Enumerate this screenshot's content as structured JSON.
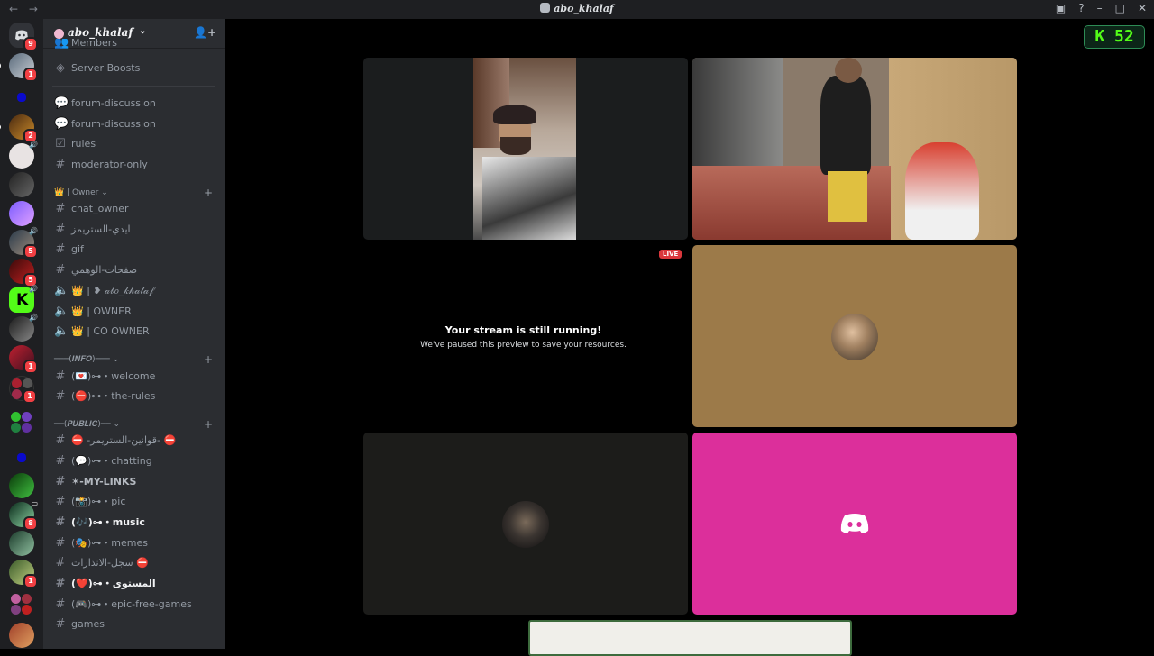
{
  "titlebar": {
    "title": "abo_khalaf",
    "back": "←",
    "forward": "→"
  },
  "servers": [
    {
      "badge": "9"
    },
    {
      "badge": "1"
    },
    {
      "badge": ""
    },
    {
      "badge": "2"
    },
    {
      "badge": ""
    },
    {
      "badge": ""
    },
    {
      "badge": ""
    },
    {
      "badge": "5"
    },
    {
      "badge": "5"
    },
    {
      "badge": ""
    },
    {
      "badge": ""
    },
    {
      "badge": "1"
    },
    {
      "badge": "1"
    },
    {
      "badge": ""
    },
    {
      "badge": ""
    },
    {
      "badge": ""
    },
    {
      "badge": "8"
    },
    {
      "badge": ""
    },
    {
      "badge": "1"
    },
    {
      "badge": ""
    },
    {
      "badge": ""
    }
  ],
  "sidebar": {
    "server_name": "abo_khalaf",
    "channels": {
      "members": "Members",
      "server_boosts": "Server Boosts",
      "forum1": "forum-discussion",
      "forum2": "forum-discussion",
      "rules": "rules",
      "moderator": "moderator-only",
      "cat_owner": "👑 | Owner",
      "chat_owner": "chat_owner",
      "streamers_id": "ايدي-الستريمز",
      "gif": "gif",
      "fake_pages": "صفحات-الوهمي",
      "voice1": "👑 | ❥ 𝒶𝒷𝑜_𝓀𝒽𝒶𝓁𝒶𝒻",
      "voice2": "👑 | OWNER",
      "voice3": "👑 | CO OWNER",
      "cat_info": "───(𝑰𝑵𝑭𝑶)───",
      "welcome": "(💌)⊶・welcome",
      "the_rules": "(⛔)⊶・the-rules",
      "cat_public": "──(𝑷𝑼𝑩𝑳𝑰𝑪)──",
      "streamer_rules": "⛔ -قوانين-الستريمر- ⛔",
      "chatting": "(💬)⊶・chatting",
      "my_links": "✶-MY-LINKS",
      "pic": "(📸)⊶・pic",
      "music": "(🎶)⊶・music",
      "memes": "(🎭)⊶・memes",
      "warnings": "سجل-الانذارات ⛔",
      "level": "(❤️)⊶・المستوى",
      "epic": "(🎮)⊶・epic-free-games",
      "games": "games"
    }
  },
  "stage": {
    "kick_badge": "K 52",
    "live_label": "LIVE",
    "stream_title": "Your stream is still running!",
    "stream_sub": "We've paused this preview to save your resources."
  },
  "colors": {
    "tile_brown": "#9c7a49",
    "tile_pink": "#dc2f9b",
    "tile_dark": "#1c1c1a",
    "sidebar_bg": "#2b2d31",
    "rail_bg": "#1e1f22"
  }
}
